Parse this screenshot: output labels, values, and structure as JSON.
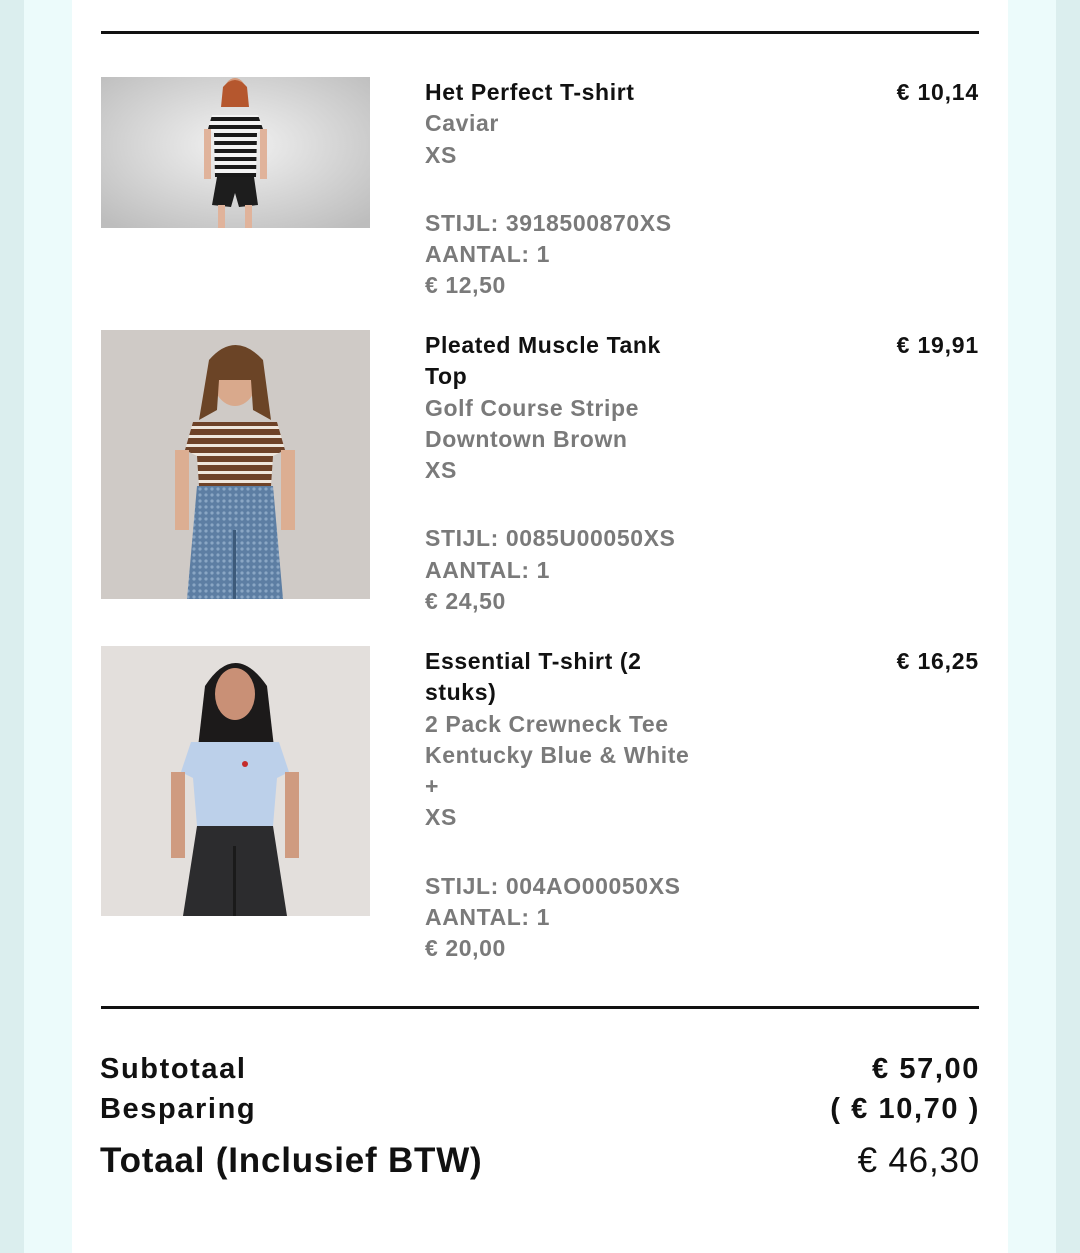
{
  "items": [
    {
      "name": "Het Perfect T-shirt",
      "color_lines": [
        "Caviar"
      ],
      "size": "XS",
      "style": "STIJL: 3918500870XS",
      "qty": "AANTAL: 1",
      "unit_price": "€ 12,50",
      "price": "€ 10,14",
      "image": "product-photo-striped-tee"
    },
    {
      "name": "Pleated Muscle Tank Top",
      "color_lines": [
        "Golf Course Stripe Downtown Brown"
      ],
      "size": "XS",
      "style": "STIJL: 0085U00050XS",
      "qty": "AANTAL: 1",
      "unit_price": "€ 24,50",
      "price": "€ 19,91",
      "image": "product-photo-brown-stripe-tank"
    },
    {
      "name": "Essential T-shirt (2 stuks)",
      "color_lines": [
        "2 Pack Crewneck Tee Kentucky Blue & White +"
      ],
      "size": "XS",
      "style": "STIJL: 004AO00050XS",
      "qty": "AANTAL: 1",
      "unit_price": "€ 20,00",
      "price": "€ 16,25",
      "image": "product-photo-blue-crewneck"
    }
  ],
  "summary": {
    "subtotal_label": "Subtotaal",
    "subtotal_value": "€ 57,00",
    "savings_label": "Besparing",
    "savings_value": "( € 10,70 )",
    "total_label": "Totaal (Inclusief BTW)",
    "total_value": "€ 46,30"
  },
  "colors": {
    "text_primary": "#111111",
    "text_muted": "#7a7a7a",
    "side_band": "#dbeeee",
    "side_band_inner": "#ecfbfb"
  }
}
